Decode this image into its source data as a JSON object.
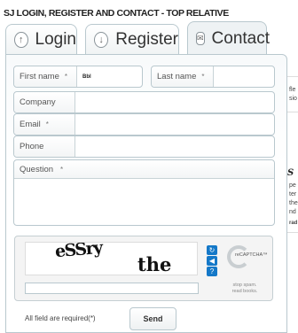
{
  "page_title": "SJ LOGIN, REGISTER AND CONTACT - TOP RELATIVE",
  "tabs": [
    {
      "label": "Login",
      "icon": "login-icon"
    },
    {
      "label": "Register",
      "icon": "register-icon"
    },
    {
      "label": "Contact",
      "icon": "contact-icon",
      "active": true
    }
  ],
  "form": {
    "required_marker": "*",
    "first_name": {
      "label": "First name",
      "value": "Bbl"
    },
    "last_name": {
      "label": "Last name",
      "value": ""
    },
    "company": {
      "label": "Company",
      "value": ""
    },
    "email": {
      "label": "Email",
      "value": ""
    },
    "phone": {
      "label": "Phone",
      "value": ""
    },
    "question": {
      "label": "Question",
      "value": ""
    },
    "required_note": "All field are required(*)",
    "send_label": "Send"
  },
  "captcha": {
    "word1": "eSSry",
    "word2": "the",
    "brand": "reCAPTCHA™",
    "tagline_1": "stop spam.",
    "tagline_2": "read books.",
    "buttons": [
      {
        "name": "refresh-icon",
        "glyph": "↻"
      },
      {
        "name": "audio-icon",
        "glyph": "◀"
      },
      {
        "name": "help-icon",
        "glyph": "?"
      }
    ]
  },
  "background_fragments": [
    "fle",
    "sio",
    "S",
    "pe",
    "ter",
    "the",
    "nd",
    "rad"
  ]
}
